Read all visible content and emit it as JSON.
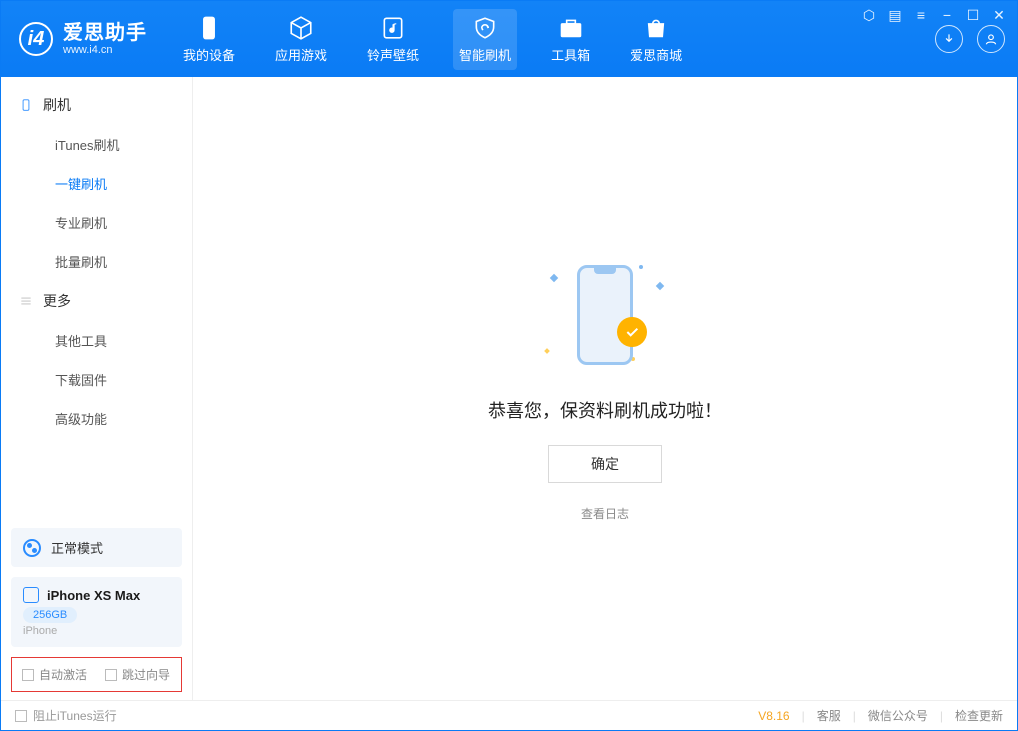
{
  "app": {
    "name": "爱思助手",
    "site": "www.i4.cn"
  },
  "nav": {
    "my_device": "我的设备",
    "apps_games": "应用游戏",
    "ringtone_wallpaper": "铃声壁纸",
    "smart_flash": "智能刷机",
    "toolbox": "工具箱",
    "store": "爱思商城"
  },
  "sidebar": {
    "group_flash": "刷机",
    "items_flash": {
      "itunes": "iTunes刷机",
      "one_key": "一键刷机",
      "pro": "专业刷机",
      "batch": "批量刷机"
    },
    "group_more": "更多",
    "items_more": {
      "other_tools": "其他工具",
      "download_firmware": "下载固件",
      "advanced": "高级功能"
    },
    "mode": "正常模式",
    "device": {
      "name": "iPhone XS Max",
      "storage": "256GB",
      "type": "iPhone"
    },
    "checks": {
      "auto_activate": "自动激活",
      "skip_guide": "跳过向导"
    }
  },
  "main": {
    "success": "恭喜您，保资料刷机成功啦！",
    "ok": "确定",
    "view_log": "查看日志"
  },
  "footer": {
    "block_itunes": "阻止iTunes运行",
    "version": "V8.16",
    "support": "客服",
    "wechat": "微信公众号",
    "check_update": "检查更新"
  }
}
